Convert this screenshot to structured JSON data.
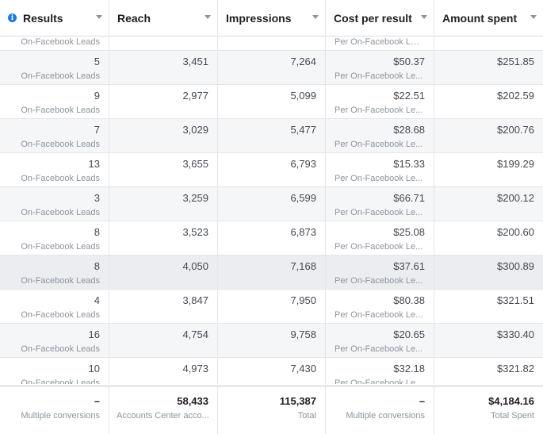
{
  "columns": [
    "Results",
    "Reach",
    "Impressions",
    "Cost per result",
    "Amount spent"
  ],
  "partial_top": {
    "results_sub": "On-Facebook Leads",
    "cpr_sub": "Per On-Facebook Leads"
  },
  "rows": [
    {
      "results": "5",
      "results_sub": "On-Facebook Leads",
      "reach": "3,451",
      "impressions": "7,264",
      "cpr": "$50.37",
      "cpr_sub": "Per On-Facebook Le...",
      "spent": "$251.85"
    },
    {
      "results": "9",
      "results_sub": "On-Facebook Leads",
      "reach": "2,977",
      "impressions": "5,099",
      "cpr": "$22.51",
      "cpr_sub": "Per On-Facebook Le...",
      "spent": "$202.59"
    },
    {
      "results": "7",
      "results_sub": "On-Facebook Leads",
      "reach": "3,029",
      "impressions": "5,477",
      "cpr": "$28.68",
      "cpr_sub": "Per On-Facebook Le...",
      "spent": "$200.76"
    },
    {
      "results": "13",
      "results_sub": "On-Facebook Leads",
      "reach": "3,655",
      "impressions": "6,793",
      "cpr": "$15.33",
      "cpr_sub": "Per On-Facebook Le...",
      "spent": "$199.29"
    },
    {
      "results": "3",
      "results_sub": "On-Facebook Leads",
      "reach": "3,259",
      "impressions": "6,599",
      "cpr": "$66.71",
      "cpr_sub": "Per On-Facebook Le...",
      "spent": "$200.12"
    },
    {
      "results": "8",
      "results_sub": "On-Facebook Leads",
      "reach": "3,523",
      "impressions": "6,873",
      "cpr": "$25.08",
      "cpr_sub": "Per On-Facebook Le...",
      "spent": "$200.60"
    },
    {
      "results": "8",
      "results_sub": "On-Facebook Leads",
      "reach": "4,050",
      "impressions": "7,168",
      "cpr": "$37.61",
      "cpr_sub": "Per On-Facebook Le...",
      "spent": "$300.89"
    },
    {
      "results": "4",
      "results_sub": "On-Facebook Leads",
      "reach": "3,847",
      "impressions": "7,950",
      "cpr": "$80.38",
      "cpr_sub": "Per On-Facebook Le...",
      "spent": "$321.51"
    },
    {
      "results": "16",
      "results_sub": "On-Facebook Leads",
      "reach": "4,754",
      "impressions": "9,758",
      "cpr": "$20.65",
      "cpr_sub": "Per On-Facebook Le...",
      "spent": "$330.40"
    },
    {
      "results": "10",
      "results_sub": "On-Facebook Leads",
      "reach": "4,973",
      "impressions": "7,430",
      "cpr": "$32.18",
      "cpr_sub": "Per On-Facebook Le...",
      "spent": "$321.82"
    }
  ],
  "totals": {
    "results": "–",
    "results_sub": "Multiple conversions",
    "reach": "58,433",
    "reach_sub": "Accounts Center acco...",
    "impressions": "115,387",
    "impressions_sub": "Total",
    "cpr": "–",
    "cpr_sub": "Multiple conversions",
    "spent": "$4,184.16",
    "spent_sub": "Total Spent"
  },
  "colors": {
    "accent": "#1877f2",
    "row_alt": "#f5f6f7",
    "row_selected": "#ebedf0"
  }
}
